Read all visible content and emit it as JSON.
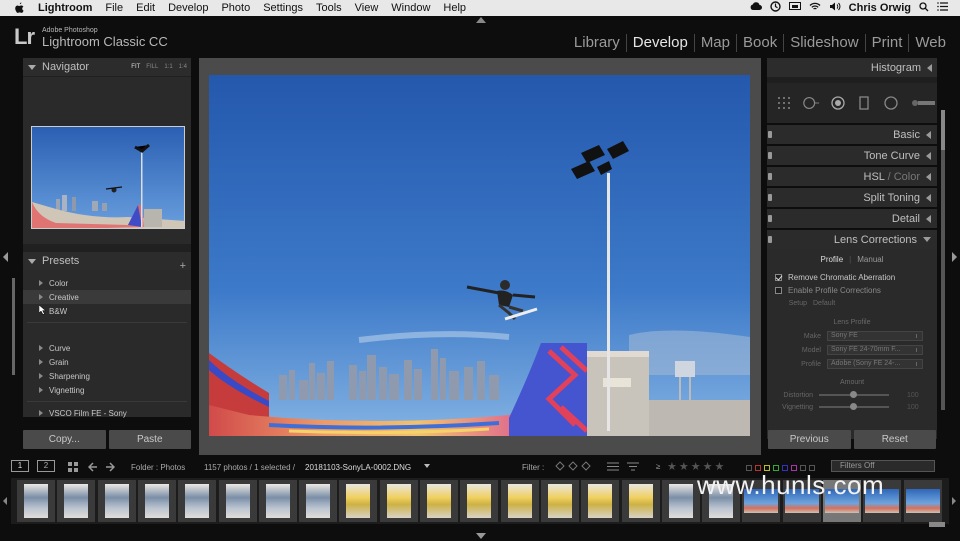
{
  "menubar": {
    "app": "Lightroom",
    "items": [
      "File",
      "Edit",
      "Develop",
      "Photo",
      "Settings",
      "Tools",
      "View",
      "Window",
      "Help"
    ],
    "user": "Chris Orwig"
  },
  "identity": {
    "logo": "Lr",
    "line1": "Adobe Photoshop",
    "line2": "Lightroom Classic CC"
  },
  "modules": [
    "Library",
    "Develop",
    "Map",
    "Book",
    "Slideshow",
    "Print",
    "Web"
  ],
  "active_module": "Develop",
  "navigator": {
    "title": "Navigator",
    "zoom": [
      "FIT",
      "FILL",
      "1:1",
      "1:4"
    ]
  },
  "presets": {
    "title": "Presets",
    "items": [
      "Color",
      "Creative",
      "B&W",
      "Curve",
      "Grain",
      "Sharpening",
      "Vignetting",
      "VSCO Film FE - Sony"
    ]
  },
  "left_buttons": {
    "copy": "Copy...",
    "paste": "Paste"
  },
  "right_panel": {
    "histogram": "Histogram",
    "panels": [
      "Basic",
      "Tone Curve",
      "HSL",
      "Color",
      "Split Toning",
      "Detail",
      "Lens Corrections"
    ],
    "hsl_sep": " / "
  },
  "lens": {
    "tabs": [
      "Profile",
      "Manual"
    ],
    "remove_ca": "Remove Chromatic Aberration",
    "enable_profile": "Enable Profile Corrections",
    "setup_label": "Setup",
    "setup_value": "Default",
    "lens_profile": "Lens Profile",
    "make_label": "Make",
    "make_value": "Sony FE",
    "model_label": "Model",
    "model_value": "Sony FE 24-70mm F...",
    "profile_label": "Profile",
    "profile_value": "Adobe (Sony FE 24-...",
    "amount": "Amount",
    "distortion": "Distortion",
    "vignetting": "Vignetting",
    "distortion_val": "100",
    "vignetting_val": "100"
  },
  "right_buttons": {
    "previous": "Previous",
    "reset": "Reset"
  },
  "toolbar": {
    "page1": "1",
    "page2": "2",
    "folder": "Folder : Photos",
    "count": "1157 photos / 1 selected /",
    "filename": "20181103-SonyLA-0002.DNG",
    "filter_label": "Filter :",
    "filter_value": "Filters Off"
  },
  "watermark": "www.hunls.com",
  "colors": {
    "panel": "#2a2a2a",
    "header": "#2c2c2c",
    "button": "#4a4a4a",
    "sky": "#2f66b8"
  }
}
